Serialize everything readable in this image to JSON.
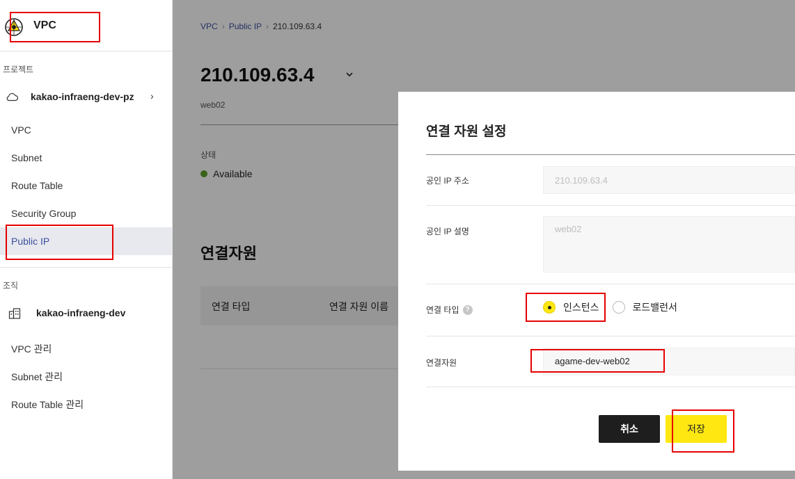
{
  "sidebar": {
    "logo_text": "VPC",
    "project_section_label": "프로젝트",
    "project_name": "kakao-infraeng-dev-pz",
    "project_chevron": "›",
    "nav_items": [
      {
        "label": "VPC"
      },
      {
        "label": "Subnet"
      },
      {
        "label": "Route Table"
      },
      {
        "label": "Security Group"
      },
      {
        "label": "Public IP"
      }
    ],
    "org_section_label": "조직",
    "org_name": "kakao-infraeng-dev",
    "org_items": [
      {
        "label": "VPC 관리"
      },
      {
        "label": "Subnet 관리"
      },
      {
        "label": "Route Table 관리"
      }
    ]
  },
  "main": {
    "breadcrumb": [
      "VPC",
      "Public IP",
      "210.109.63.4"
    ],
    "title": "210.109.63.4",
    "subtitle": "web02",
    "status_label": "상태",
    "status_value": "Available",
    "section_title": "연결자원",
    "table_headers": [
      "연결 타입",
      "연결 자원 이름"
    ]
  },
  "modal": {
    "title": "연결 자원 설정",
    "ip_label": "공인 IP 주소",
    "ip_value": "210.109.63.4",
    "desc_label": "공인 IP 설명",
    "desc_value": "web02",
    "type_label": "연결 타입",
    "help_glyph": "?",
    "radio_options": [
      {
        "label": "인스턴스",
        "selected": true
      },
      {
        "label": "로드밸런서",
        "selected": false
      }
    ],
    "resource_label": "연결자원",
    "resource_value": "agame-dev-web02",
    "cancel_label": "취소",
    "save_label": "저장"
  },
  "colors": {
    "accent_yellow": "#ffe812",
    "active_nav_text": "#3d4fa0",
    "status_green": "#5aa02c",
    "annotation_red": "#e60000"
  }
}
